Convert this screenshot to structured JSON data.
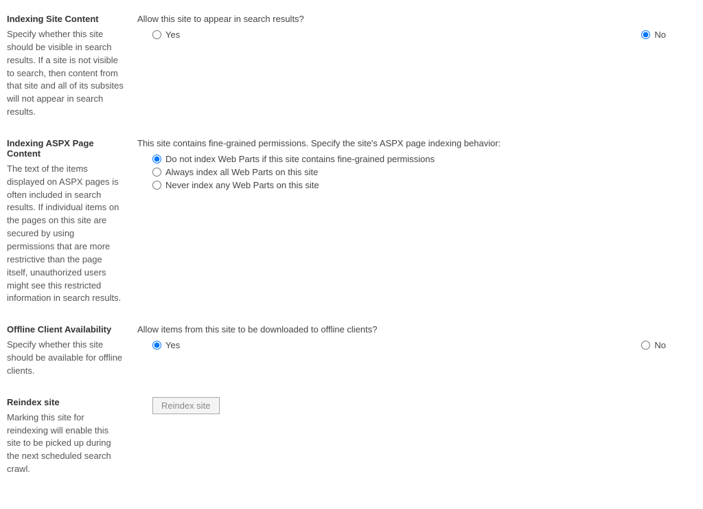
{
  "sections": {
    "indexing_site": {
      "heading": "Indexing Site Content",
      "desc": "Specify whether this site should be visible in search results. If a site is not visible to search, then content from that site and all of its subsites will not appear in search results.",
      "prompt": "Allow this site to appear in search results?",
      "yes": "Yes",
      "no": "No"
    },
    "indexing_aspx": {
      "heading": "Indexing ASPX Page Content",
      "desc": "The text of the items displayed on ASPX pages is often included in search results. If individual items on the pages on this site are secured by using permissions that are more restrictive than the page itself, unauthorized users might see this restricted information in search results.",
      "prompt": "This site contains fine-grained permissions. Specify the site's ASPX page indexing behavior:",
      "opt1": "Do not index Web Parts if this site contains fine-grained permissions",
      "opt2": "Always index all Web Parts on this site",
      "opt3": "Never index any Web Parts on this site"
    },
    "offline": {
      "heading": "Offline Client Availability",
      "desc": "Specify whether this site should be available for offline clients.",
      "prompt": "Allow items from this site to be downloaded to offline clients?",
      "yes": "Yes",
      "no": "No"
    },
    "reindex": {
      "heading": "Reindex site",
      "desc": "Marking this site for reindexing will enable this site to be picked up during the next scheduled search crawl.",
      "button": "Reindex site"
    }
  }
}
